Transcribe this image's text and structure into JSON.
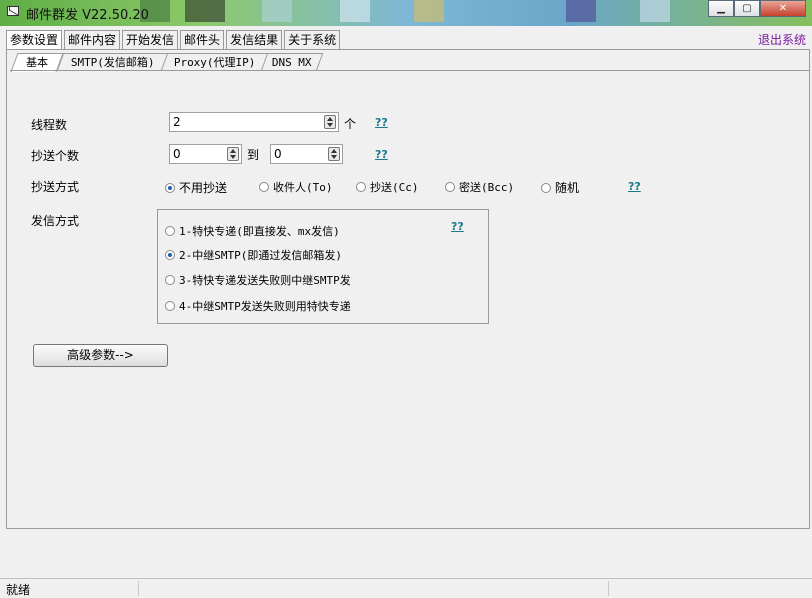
{
  "window": {
    "title": "邮件群发 V22.50.20",
    "exit_label": "退出系统"
  },
  "main_tabs": [
    "参数设置",
    "邮件内容",
    "开始发信",
    "邮件头",
    "发信结果",
    "关于系统"
  ],
  "sub_tabs": [
    "基本",
    "SMTP(发信邮箱)",
    "Proxy(代理IP)",
    "DNS MX"
  ],
  "form": {
    "threads": {
      "label": "线程数",
      "value": "2",
      "unit": "个",
      "help": "??"
    },
    "cc_count": {
      "label": "抄送个数",
      "from": "0",
      "to_label": "到",
      "to": "0",
      "help": "??"
    },
    "cc_mode": {
      "label": "抄送方式",
      "options": [
        "不用抄送",
        "收件人(To)",
        "抄送(Cc)",
        "密送(Bcc)",
        "随机"
      ],
      "selected": "不用抄送",
      "help": "??"
    },
    "send_mode": {
      "label": "发信方式",
      "options": [
        "1-特快专递(即直接发、mx发信)",
        "2-中继SMTP(即通过发信邮箱发)",
        "3-特快专递发送失败则中继SMTP发",
        "4-中继SMTP发送失败则用特快专递"
      ],
      "selected": "2-中继SMTP(即通过发信邮箱发)",
      "help": "??"
    },
    "advanced_button": "高级参数-->"
  },
  "status": {
    "text": "就绪"
  },
  "icons": {
    "app": "mail-icon",
    "minimize": "minimize-icon",
    "maximize": "maximize-icon",
    "close": "close-icon"
  },
  "colors": {
    "exit_link": "#7a1aa0",
    "help_link": "#1a7a8a"
  }
}
